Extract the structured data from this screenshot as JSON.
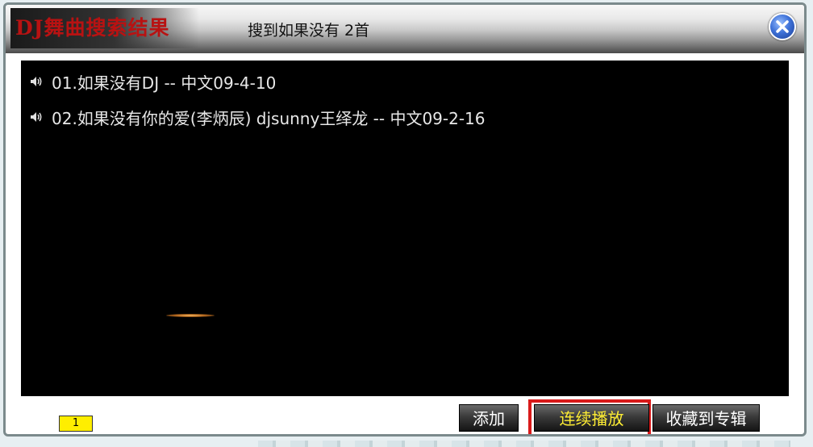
{
  "window": {
    "title": "DJ舞曲搜索结果",
    "summary": "搜到如果没有 2首"
  },
  "tracks": [
    {
      "label": "01.如果没有DJ -- 中文09-4-10",
      "icon": "speaker-icon"
    },
    {
      "label": "02.如果没有你的爱(李炳辰) djsunny王绎龙 -- 中文09-2-16",
      "icon": "speaker-icon"
    }
  ],
  "pagination": {
    "current_page": "1"
  },
  "buttons": {
    "add": "添加",
    "play_all": "连续播放",
    "add_to_album": "收藏到专辑"
  },
  "colors": {
    "title_text": "#b81212",
    "list_background": "#000000",
    "play_all_text": "#ffee33",
    "highlight_border": "#d91a1a",
    "page_indicator": "#ffee00"
  }
}
